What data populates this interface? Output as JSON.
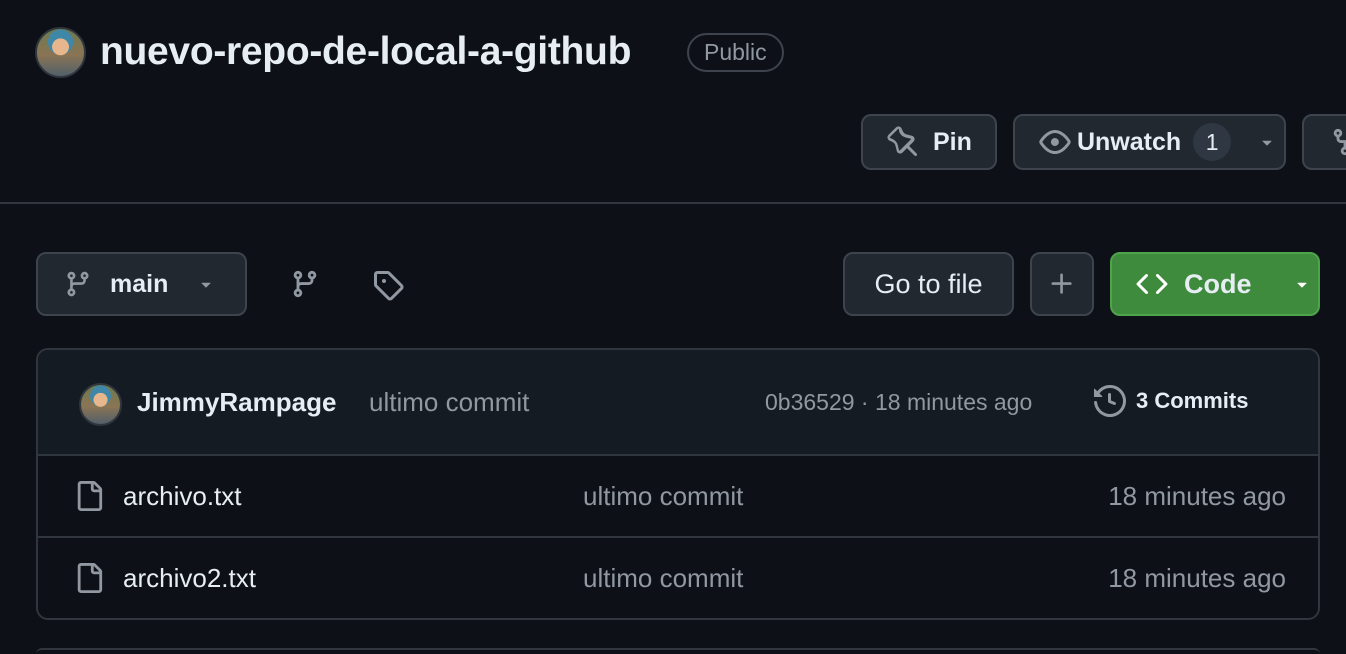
{
  "repo": {
    "name": "nuevo-repo-de-local-a-github",
    "visibility": "Public"
  },
  "actions": {
    "pin_label": "Pin",
    "watch_label": "Unwatch",
    "watch_count": "1"
  },
  "toolbar": {
    "branch": "main",
    "goto_file_label": "Go to file",
    "code_label": "Code"
  },
  "latest_commit": {
    "author": "JimmyRampage",
    "message": "ultimo commit",
    "meta": "0b36529 · 18 minutes ago",
    "commits_label": "3 Commits"
  },
  "files": [
    {
      "name": "archivo.txt",
      "message": "ultimo commit",
      "time": "18 minutes ago"
    },
    {
      "name": "archivo2.txt",
      "message": "ultimo commit",
      "time": "18 minutes ago"
    }
  ],
  "colors": {
    "background": "#0d1117",
    "code_button": "#3f8b3e",
    "border": "#30363d",
    "muted_text": "#9198a1"
  },
  "icons": [
    "pin-icon",
    "eye-icon",
    "triangle-down-icon",
    "repo-forked-icon",
    "git-branch-icon",
    "tag-icon",
    "plus-icon",
    "code-icon",
    "history-icon",
    "file-icon"
  ]
}
